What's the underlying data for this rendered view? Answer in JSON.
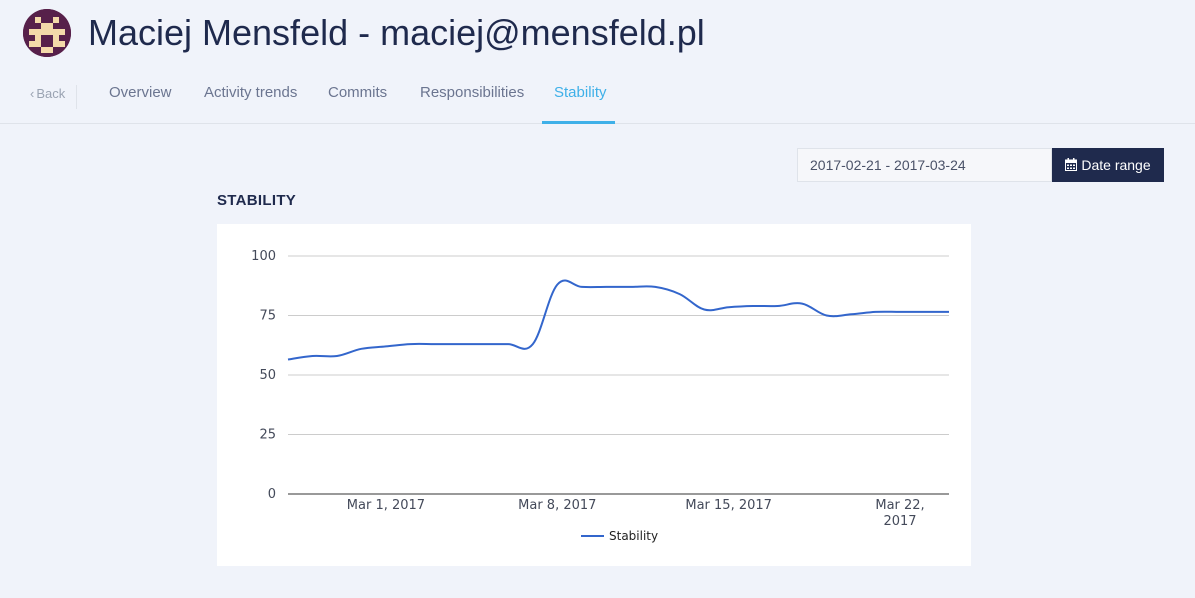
{
  "header": {
    "title": "Maciej Mensfeld - maciej@mensfeld.pl",
    "avatar_icon": "pixel-invader-icon",
    "avatar_bg": "#57204a"
  },
  "nav": {
    "back_label": "Back",
    "tabs": [
      {
        "label": "Overview",
        "active": false
      },
      {
        "label": "Activity trends",
        "active": false
      },
      {
        "label": "Commits",
        "active": false
      },
      {
        "label": "Responsibilities",
        "active": false
      },
      {
        "label": "Stability",
        "active": true
      }
    ],
    "active_color": "#3fb0e8"
  },
  "date_range": {
    "value": "2017-02-21 - 2017-03-24",
    "button_label": "Date range",
    "button_icon": "calendar-icon"
  },
  "section": {
    "title": "STABILITY"
  },
  "chart_data": {
    "type": "line",
    "title": "",
    "xlabel": "",
    "ylabel": "",
    "ylim": [
      0,
      100
    ],
    "yticks": [
      0,
      25,
      50,
      75,
      100
    ],
    "grid": true,
    "legend_position": "bottom",
    "xtick_labels": [
      {
        "x": "2017-03-01",
        "lines": [
          "Mar 1, 2017"
        ]
      },
      {
        "x": "2017-03-08",
        "lines": [
          "Mar 8, 2017"
        ]
      },
      {
        "x": "2017-03-15",
        "lines": [
          "Mar 15, 2017"
        ]
      },
      {
        "x": "2017-03-22",
        "lines": [
          "Mar 22,",
          "2017"
        ]
      }
    ],
    "x_domain": [
      "2017-02-25",
      "2017-03-24"
    ],
    "series": [
      {
        "name": "Stability",
        "color": "#3366cc",
        "x": [
          "2017-02-25",
          "2017-02-26",
          "2017-02-27",
          "2017-02-28",
          "2017-03-01",
          "2017-03-02",
          "2017-03-03",
          "2017-03-04",
          "2017-03-05",
          "2017-03-06",
          "2017-03-07",
          "2017-03-08",
          "2017-03-09",
          "2017-03-10",
          "2017-03-11",
          "2017-03-12",
          "2017-03-13",
          "2017-03-14",
          "2017-03-15",
          "2017-03-16",
          "2017-03-17",
          "2017-03-18",
          "2017-03-19",
          "2017-03-20",
          "2017-03-21",
          "2017-03-22",
          "2017-03-23",
          "2017-03-24"
        ],
        "values": [
          56.5,
          58,
          58,
          61,
          62,
          63,
          63,
          63,
          63,
          63,
          63,
          88,
          87,
          87,
          87,
          87,
          84,
          77.5,
          78.5,
          79,
          79,
          80,
          75,
          75.5,
          76.5,
          76.5,
          76.5,
          76.5
        ]
      }
    ]
  }
}
